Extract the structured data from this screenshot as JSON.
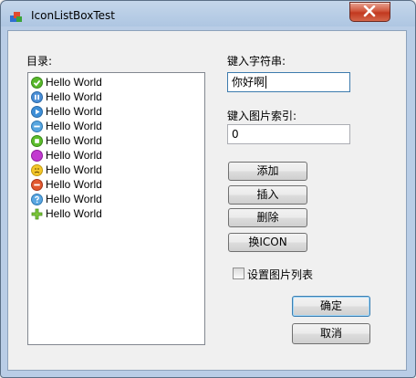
{
  "window": {
    "title": "IconListBoxTest"
  },
  "labels": {
    "list_label": "目录:",
    "string_label": "键入字符串:",
    "index_label": "键入图片索引:"
  },
  "inputs": {
    "string_value": "你好啊",
    "index_value": "0"
  },
  "list": {
    "items": [
      {
        "label": "Hello World",
        "icon": "green-check-icon"
      },
      {
        "label": "Hello World",
        "icon": "blue-pause-icon"
      },
      {
        "label": "Hello World",
        "icon": "blue-play-icon"
      },
      {
        "label": "Hello World",
        "icon": "blue-minus-icon"
      },
      {
        "label": "Hello World",
        "icon": "green-stop-icon"
      },
      {
        "label": "Hello World",
        "icon": "purple-circle-icon"
      },
      {
        "label": "Hello World",
        "icon": "yellow-warning-icon"
      },
      {
        "label": "Hello World",
        "icon": "red-minus-icon"
      },
      {
        "label": "Hello World",
        "icon": "blue-question-icon"
      },
      {
        "label": "Hello World",
        "icon": "green-plus-icon"
      }
    ]
  },
  "buttons": {
    "add": "添加",
    "insert": "插入",
    "delete": "删除",
    "change_icon": "换ICON",
    "ok": "确定",
    "cancel": "取消"
  },
  "checkbox": {
    "label": "设置图片列表",
    "checked": false
  },
  "colors": {
    "window_frame": "#b9cde6",
    "client_bg": "#f0f0f0",
    "close_red": "#c2381f",
    "focus_border": "#3d7bad"
  }
}
